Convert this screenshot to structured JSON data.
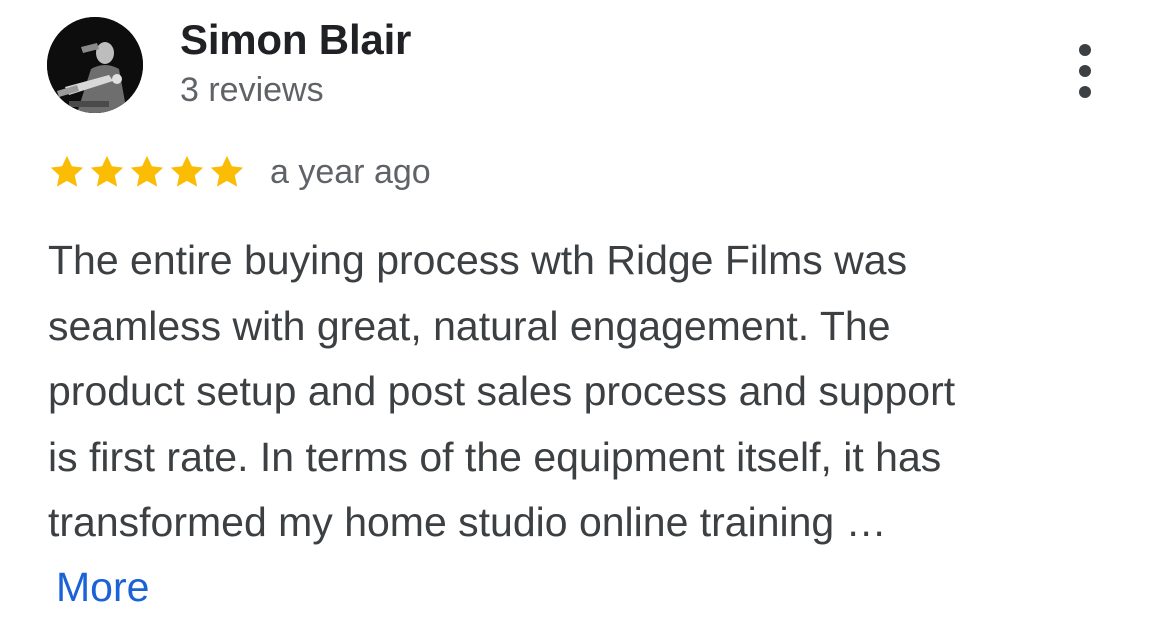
{
  "review": {
    "author": {
      "name": "Simon Blair",
      "review_count": "3 reviews",
      "avatar_icon": "user-photo-avatar"
    },
    "menu_icon": "more-vert-icon",
    "rating": {
      "stars": 5,
      "max_stars": 5,
      "star_color": "#fbbc04"
    },
    "date": "a year ago",
    "text_lines": [
      "The entire buying process wth Ridge Films was",
      "seamless with great, natural engagement. The",
      "product setup and post sales process and support",
      "is first rate. In terms of the equipment itself, it has",
      "transformed my home studio online training …"
    ],
    "more_label": "More",
    "link_color": "#1a62d6"
  }
}
